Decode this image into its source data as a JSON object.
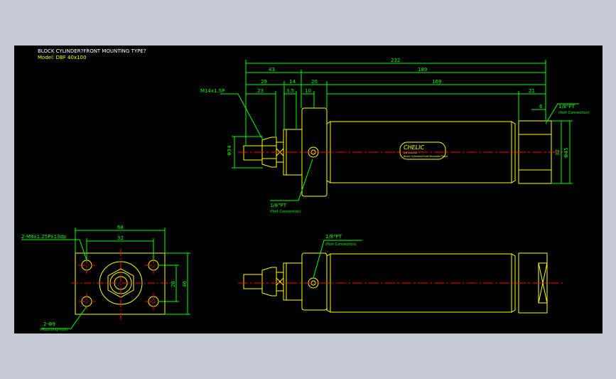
{
  "colors": {
    "viewer_bg": "#c5cbd4",
    "canvas_bg": "#000000",
    "outline": "#ffff00",
    "dimension": "#00ff00",
    "centerline": "#ff0000",
    "title_text": "#ffffff",
    "model_text": "#ffff00"
  },
  "drawing": {
    "title": "BLOCK CYLINDER?FRONT MOUNTING TYPE?",
    "model": "Model: DBF 40x100"
  },
  "dimensions": {
    "side_top": {
      "overall": "232",
      "d43": "43",
      "d189": "189",
      "d29": "29",
      "d14": "14",
      "d20": "20",
      "d23": "23",
      "d35": "3.5",
      "d10": "10",
      "d169": "169",
      "d21": "21",
      "d6": "6",
      "thread": "M14x1.5P",
      "height_left": "Φ34",
      "height_32": "32",
      "dia_45": "Φ45"
    },
    "side_top_ports": {
      "rear_port": "1/8\"PT",
      "rear_port_note": "(Port Connection)",
      "front_port": "1/8\"PT",
      "front_port_note": "(Port Connection)"
    },
    "front_view": {
      "width_68": "68",
      "width_32": "32",
      "height_28": "28",
      "height_46": "46",
      "thread_holes": "2-M8x1.25Px13dp",
      "mount_holes": "2-Φ9",
      "mount_note": "(Mounting-hole)"
    },
    "side_bottom": {
      "port": "1/8\"PT",
      "port_note": "(Port Connection)"
    }
  },
  "label_plate": {
    "brand": "CHELIC",
    "line1": "DB 40x100",
    "line2": "Block Cylinder(Front Mounted Type)"
  }
}
